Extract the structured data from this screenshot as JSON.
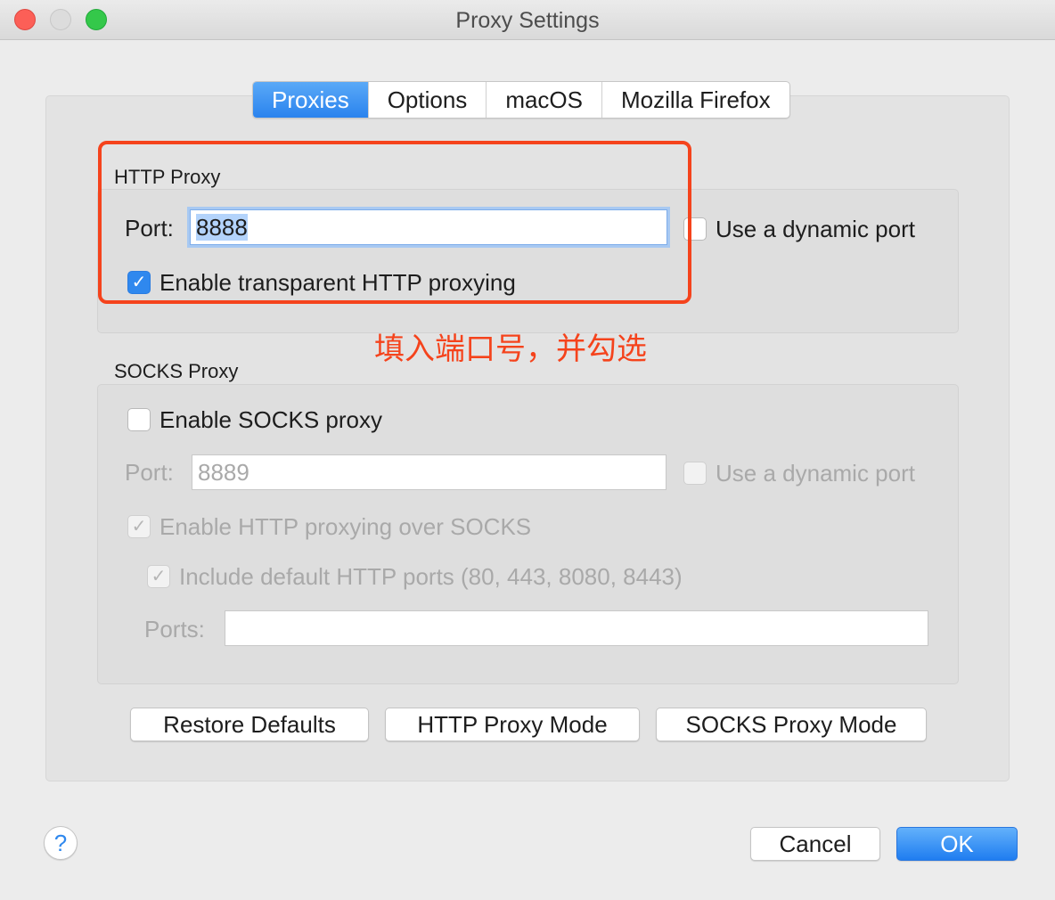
{
  "window": {
    "title": "Proxy Settings"
  },
  "tabs": [
    {
      "label": "Proxies",
      "active": true
    },
    {
      "label": "Options",
      "active": false
    },
    {
      "label": "macOS",
      "active": false
    },
    {
      "label": "Mozilla Firefox",
      "active": false
    }
  ],
  "http_proxy": {
    "section_label": "HTTP Proxy",
    "port_label": "Port:",
    "port_value": "8888",
    "dynamic_port_label": "Use a dynamic port",
    "dynamic_port_checked": false,
    "transparent_label": "Enable transparent HTTP proxying",
    "transparent_checked": true
  },
  "annotation": {
    "text": "填入端口号，并勾选",
    "color": "#f5431c"
  },
  "socks_proxy": {
    "section_label": "SOCKS Proxy",
    "enable_label": "Enable SOCKS proxy",
    "enable_checked": false,
    "port_label": "Port:",
    "port_value": "8889",
    "dynamic_port_label": "Use a dynamic port",
    "http_over_socks_label": "Enable HTTP proxying over SOCKS",
    "http_over_socks_checked": true,
    "include_default_ports_label": "Include default HTTP ports (80, 443, 8080, 8443)",
    "include_default_ports_checked": true,
    "ports_label": "Ports:",
    "ports_value": ""
  },
  "mode_buttons": {
    "restore": "Restore Defaults",
    "http_mode": "HTTP Proxy Mode",
    "socks_mode": "SOCKS Proxy Mode"
  },
  "footer": {
    "help": "?",
    "cancel": "Cancel",
    "ok": "OK"
  },
  "colors": {
    "accent": "#2f88ee",
    "annotation": "#f5431c",
    "close": "#fc5f57",
    "maximize": "#34c84a"
  }
}
